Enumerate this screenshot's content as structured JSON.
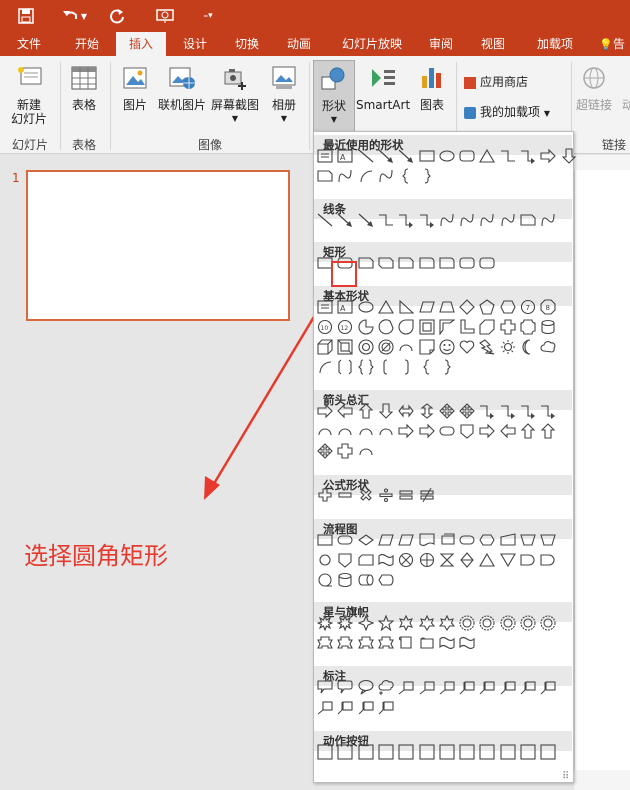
{
  "tabs": [
    "文件",
    "开始",
    "插入",
    "设计",
    "切换",
    "动画",
    "幻灯片放映",
    "审阅",
    "视图",
    "加载项"
  ],
  "tell_me": "告",
  "ribbon": {
    "new_slide": "新建\n幻灯片",
    "table": "表格",
    "picture": "图片",
    "online_picture": "联机图片",
    "screenshot": "屏幕截图",
    "album": "相册",
    "shapes": "形状",
    "smartart": "SmartArt",
    "chart": "图表",
    "store": "应用商店",
    "my_addins": "我的加载项",
    "hyperlink": "超链接",
    "action": "动",
    "groups": {
      "slides": "幻灯片",
      "tables": "表格",
      "images": "图像",
      "links": "链接"
    }
  },
  "slide_number": "1",
  "caption": "选择圆角矩形",
  "gallery": {
    "categories": [
      "最近使用的形状",
      "线条",
      "矩形",
      "基本形状",
      "箭头总汇",
      "公式形状",
      "流程图",
      "星与旗帜",
      "标注",
      "动作按钮"
    ]
  },
  "colors": {
    "accent": "#c43e1c",
    "highlight": "#e63a2e",
    "thumb_border": "#d9683d"
  }
}
